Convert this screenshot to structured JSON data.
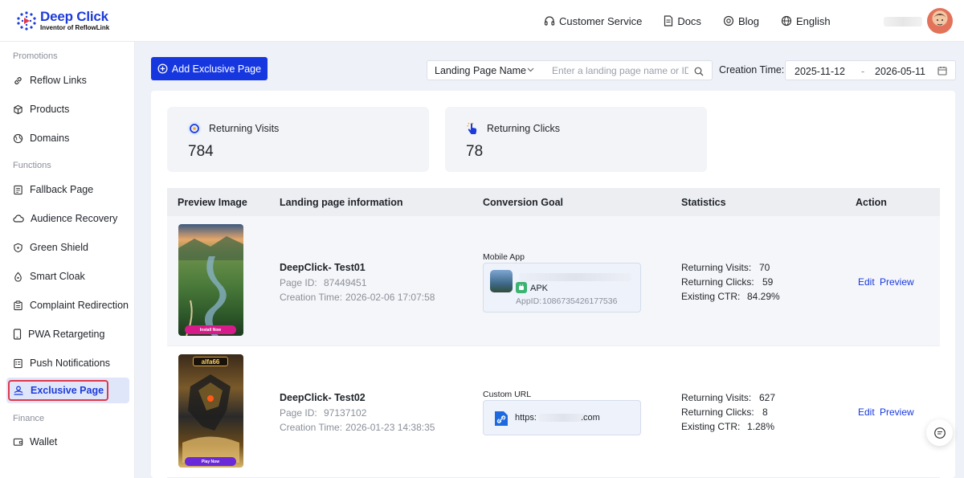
{
  "brand": {
    "name": "Deep Click",
    "tagline": "Inventor of ReflowLink"
  },
  "nav": {
    "customer_service": "Customer Service",
    "docs": "Docs",
    "blog": "Blog",
    "language": "English"
  },
  "sidebar": {
    "sections": [
      "Promotions",
      "Functions",
      "Finance"
    ],
    "items": [
      {
        "label": "Reflow Links",
        "icon": "link-icon"
      },
      {
        "label": "Products",
        "icon": "cube-icon"
      },
      {
        "label": "Domains",
        "icon": "globe-icon"
      },
      {
        "label": "Fallback Page",
        "icon": "document-icon"
      },
      {
        "label": "Audience Recovery",
        "icon": "cloud-icon"
      },
      {
        "label": "Green Shield",
        "icon": "shield-icon"
      },
      {
        "label": "Smart Cloak",
        "icon": "drop-icon"
      },
      {
        "label": "Complaint Redirection",
        "icon": "clipboard-icon"
      },
      {
        "label": "PWA Retargeting",
        "icon": "phone-icon"
      },
      {
        "label": "Push Notifications",
        "icon": "bell-list-icon"
      },
      {
        "label": "Exclusive Page",
        "icon": "user-stack-icon"
      },
      {
        "label": "Wallet",
        "icon": "wallet-icon"
      }
    ],
    "active": "Exclusive Page"
  },
  "toolbar": {
    "add_label": "Add Exclusive Page",
    "filter_field": "Landing Page Name",
    "search_placeholder": "Enter a landing page name or ID",
    "creation_time_label": "Creation Time:",
    "date_start": "2025-11-12",
    "date_separator": "-",
    "date_end": "2026-05-11"
  },
  "stats": {
    "returning_visits": {
      "label": "Returning Visits",
      "value": "784"
    },
    "returning_clicks": {
      "label": "Returning Clicks",
      "value": "78"
    }
  },
  "table": {
    "headers": [
      "Preview Image",
      "Landing page information",
      "Conversion Goal",
      "Statistics",
      "Action"
    ],
    "rows": [
      {
        "name": "DeepClick- Test01",
        "page_id_label": "Page ID:",
        "page_id": "87449451",
        "created_label": "Creation Time:",
        "created": "2026-02-06 17:07:58",
        "goal_type": "Mobile App",
        "app_badge": "APK",
        "app_id_label": "AppID:",
        "app_id": "1086735426177536",
        "preview_button": "Install Now",
        "visits_label": "Returning Visits:",
        "visits": "70",
        "clicks_label": "Returning Clicks:",
        "clicks": "59",
        "ctr_label": "Existing CTR:",
        "ctr": "84.29%",
        "edit": "Edit",
        "preview": "Preview"
      },
      {
        "name": "DeepClick- Test02",
        "page_id_label": "Page ID:",
        "page_id": "97137102",
        "created_label": "Creation Time:",
        "created": "2026-01-23 14:38:35",
        "goal_type": "Custom URL",
        "url_prefix": "https:",
        "url_suffix": ".com",
        "preview_button": "Play Now",
        "preview_brand": "alfa66",
        "visits_label": "Returning Visits:",
        "visits": "627",
        "clicks_label": "Returning Clicks:",
        "clicks": "8",
        "ctr_label": "Existing CTR:",
        "ctr": "1.28%",
        "edit": "Edit",
        "preview": "Preview"
      }
    ]
  },
  "colors": {
    "brand": "#1637e0",
    "active_bg": "#e0e6fa",
    "highlight": "#e0384a",
    "link": "#1637e0"
  }
}
